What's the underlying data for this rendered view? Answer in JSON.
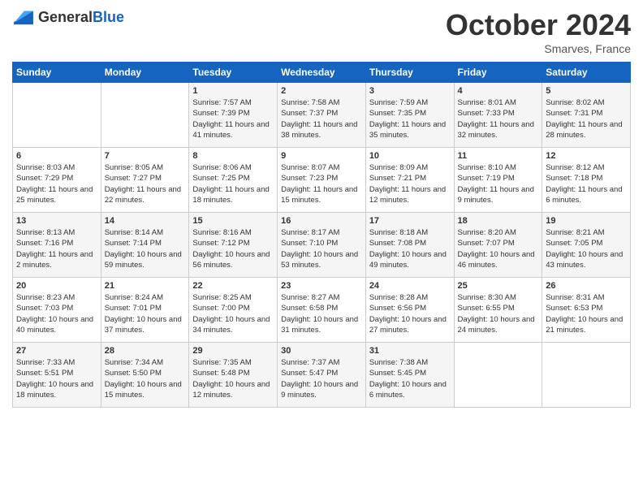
{
  "logo": {
    "general": "General",
    "blue": "Blue"
  },
  "header": {
    "month": "October 2024",
    "location": "Smarves, France"
  },
  "days_of_week": [
    "Sunday",
    "Monday",
    "Tuesday",
    "Wednesday",
    "Thursday",
    "Friday",
    "Saturday"
  ],
  "weeks": [
    [
      {
        "day": "",
        "sunrise": "",
        "sunset": "",
        "daylight": ""
      },
      {
        "day": "",
        "sunrise": "",
        "sunset": "",
        "daylight": ""
      },
      {
        "day": "1",
        "sunrise": "Sunrise: 7:57 AM",
        "sunset": "Sunset: 7:39 PM",
        "daylight": "Daylight: 11 hours and 41 minutes."
      },
      {
        "day": "2",
        "sunrise": "Sunrise: 7:58 AM",
        "sunset": "Sunset: 7:37 PM",
        "daylight": "Daylight: 11 hours and 38 minutes."
      },
      {
        "day": "3",
        "sunrise": "Sunrise: 7:59 AM",
        "sunset": "Sunset: 7:35 PM",
        "daylight": "Daylight: 11 hours and 35 minutes."
      },
      {
        "day": "4",
        "sunrise": "Sunrise: 8:01 AM",
        "sunset": "Sunset: 7:33 PM",
        "daylight": "Daylight: 11 hours and 32 minutes."
      },
      {
        "day": "5",
        "sunrise": "Sunrise: 8:02 AM",
        "sunset": "Sunset: 7:31 PM",
        "daylight": "Daylight: 11 hours and 28 minutes."
      }
    ],
    [
      {
        "day": "6",
        "sunrise": "Sunrise: 8:03 AM",
        "sunset": "Sunset: 7:29 PM",
        "daylight": "Daylight: 11 hours and 25 minutes."
      },
      {
        "day": "7",
        "sunrise": "Sunrise: 8:05 AM",
        "sunset": "Sunset: 7:27 PM",
        "daylight": "Daylight: 11 hours and 22 minutes."
      },
      {
        "day": "8",
        "sunrise": "Sunrise: 8:06 AM",
        "sunset": "Sunset: 7:25 PM",
        "daylight": "Daylight: 11 hours and 18 minutes."
      },
      {
        "day": "9",
        "sunrise": "Sunrise: 8:07 AM",
        "sunset": "Sunset: 7:23 PM",
        "daylight": "Daylight: 11 hours and 15 minutes."
      },
      {
        "day": "10",
        "sunrise": "Sunrise: 8:09 AM",
        "sunset": "Sunset: 7:21 PM",
        "daylight": "Daylight: 11 hours and 12 minutes."
      },
      {
        "day": "11",
        "sunrise": "Sunrise: 8:10 AM",
        "sunset": "Sunset: 7:19 PM",
        "daylight": "Daylight: 11 hours and 9 minutes."
      },
      {
        "day": "12",
        "sunrise": "Sunrise: 8:12 AM",
        "sunset": "Sunset: 7:18 PM",
        "daylight": "Daylight: 11 hours and 6 minutes."
      }
    ],
    [
      {
        "day": "13",
        "sunrise": "Sunrise: 8:13 AM",
        "sunset": "Sunset: 7:16 PM",
        "daylight": "Daylight: 11 hours and 2 minutes."
      },
      {
        "day": "14",
        "sunrise": "Sunrise: 8:14 AM",
        "sunset": "Sunset: 7:14 PM",
        "daylight": "Daylight: 10 hours and 59 minutes."
      },
      {
        "day": "15",
        "sunrise": "Sunrise: 8:16 AM",
        "sunset": "Sunset: 7:12 PM",
        "daylight": "Daylight: 10 hours and 56 minutes."
      },
      {
        "day": "16",
        "sunrise": "Sunrise: 8:17 AM",
        "sunset": "Sunset: 7:10 PM",
        "daylight": "Daylight: 10 hours and 53 minutes."
      },
      {
        "day": "17",
        "sunrise": "Sunrise: 8:18 AM",
        "sunset": "Sunset: 7:08 PM",
        "daylight": "Daylight: 10 hours and 49 minutes."
      },
      {
        "day": "18",
        "sunrise": "Sunrise: 8:20 AM",
        "sunset": "Sunset: 7:07 PM",
        "daylight": "Daylight: 10 hours and 46 minutes."
      },
      {
        "day": "19",
        "sunrise": "Sunrise: 8:21 AM",
        "sunset": "Sunset: 7:05 PM",
        "daylight": "Daylight: 10 hours and 43 minutes."
      }
    ],
    [
      {
        "day": "20",
        "sunrise": "Sunrise: 8:23 AM",
        "sunset": "Sunset: 7:03 PM",
        "daylight": "Daylight: 10 hours and 40 minutes."
      },
      {
        "day": "21",
        "sunrise": "Sunrise: 8:24 AM",
        "sunset": "Sunset: 7:01 PM",
        "daylight": "Daylight: 10 hours and 37 minutes."
      },
      {
        "day": "22",
        "sunrise": "Sunrise: 8:25 AM",
        "sunset": "Sunset: 7:00 PM",
        "daylight": "Daylight: 10 hours and 34 minutes."
      },
      {
        "day": "23",
        "sunrise": "Sunrise: 8:27 AM",
        "sunset": "Sunset: 6:58 PM",
        "daylight": "Daylight: 10 hours and 31 minutes."
      },
      {
        "day": "24",
        "sunrise": "Sunrise: 8:28 AM",
        "sunset": "Sunset: 6:56 PM",
        "daylight": "Daylight: 10 hours and 27 minutes."
      },
      {
        "day": "25",
        "sunrise": "Sunrise: 8:30 AM",
        "sunset": "Sunset: 6:55 PM",
        "daylight": "Daylight: 10 hours and 24 minutes."
      },
      {
        "day": "26",
        "sunrise": "Sunrise: 8:31 AM",
        "sunset": "Sunset: 6:53 PM",
        "daylight": "Daylight: 10 hours and 21 minutes."
      }
    ],
    [
      {
        "day": "27",
        "sunrise": "Sunrise: 7:33 AM",
        "sunset": "Sunset: 5:51 PM",
        "daylight": "Daylight: 10 hours and 18 minutes."
      },
      {
        "day": "28",
        "sunrise": "Sunrise: 7:34 AM",
        "sunset": "Sunset: 5:50 PM",
        "daylight": "Daylight: 10 hours and 15 minutes."
      },
      {
        "day": "29",
        "sunrise": "Sunrise: 7:35 AM",
        "sunset": "Sunset: 5:48 PM",
        "daylight": "Daylight: 10 hours and 12 minutes."
      },
      {
        "day": "30",
        "sunrise": "Sunrise: 7:37 AM",
        "sunset": "Sunset: 5:47 PM",
        "daylight": "Daylight: 10 hours and 9 minutes."
      },
      {
        "day": "31",
        "sunrise": "Sunrise: 7:38 AM",
        "sunset": "Sunset: 5:45 PM",
        "daylight": "Daylight: 10 hours and 6 minutes."
      },
      {
        "day": "",
        "sunrise": "",
        "sunset": "",
        "daylight": ""
      },
      {
        "day": "",
        "sunrise": "",
        "sunset": "",
        "daylight": ""
      }
    ]
  ]
}
